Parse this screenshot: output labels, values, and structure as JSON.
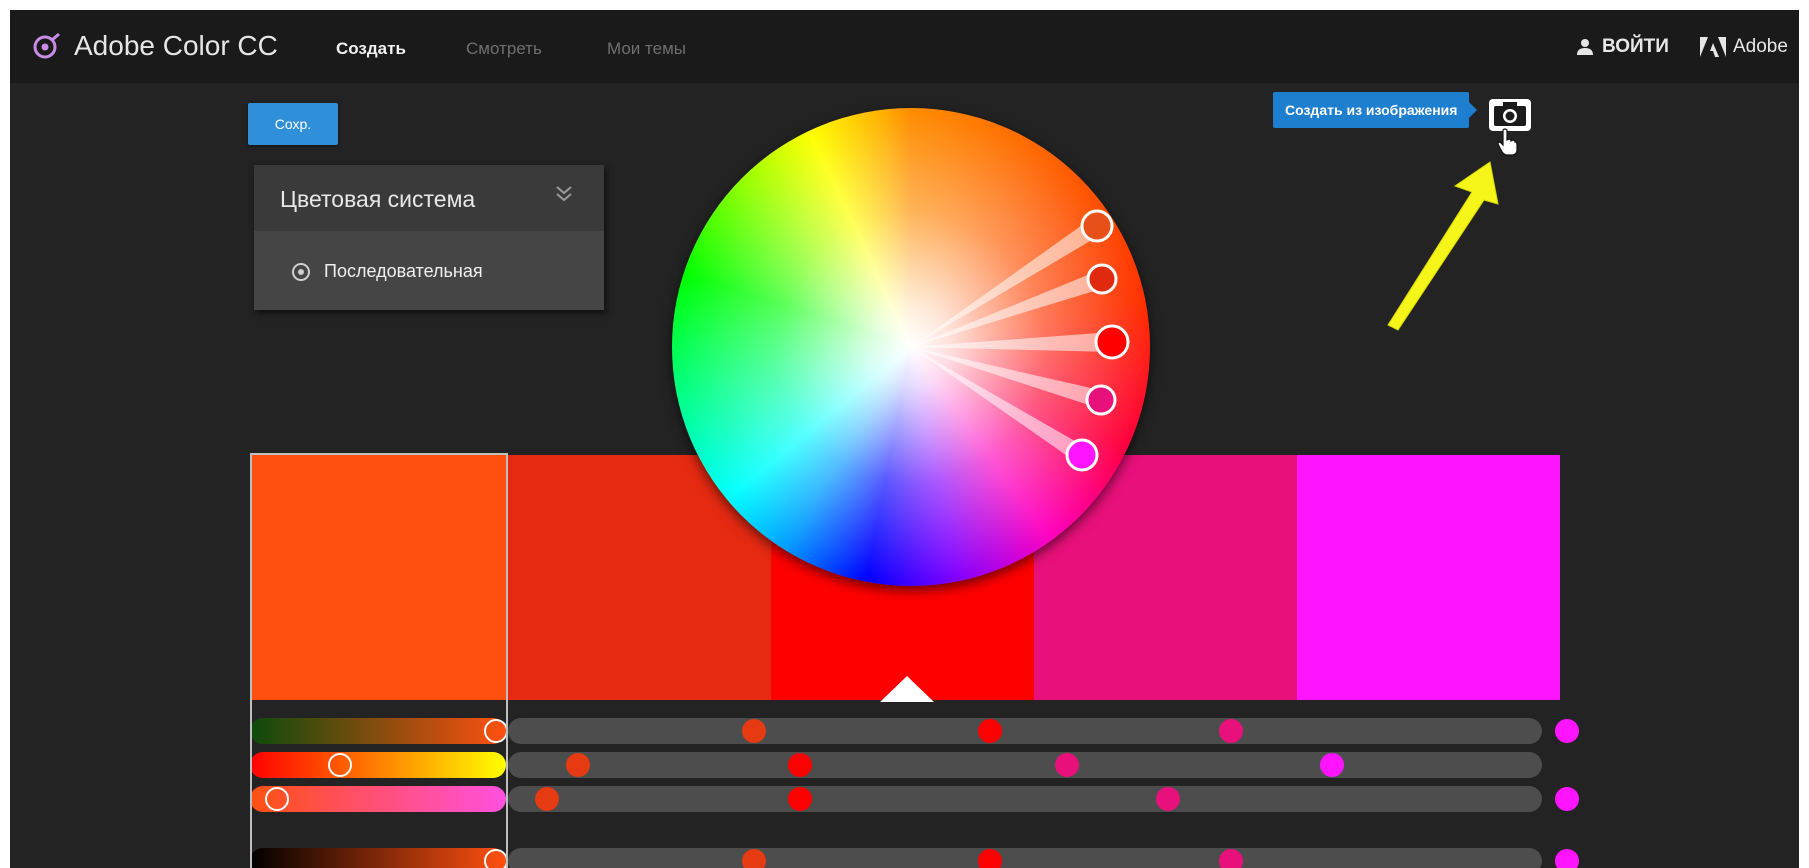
{
  "header": {
    "app_title": "Adobe Color CC",
    "nav": [
      {
        "label": "Создать",
        "active": true
      },
      {
        "label": "Смотреть",
        "active": false
      },
      {
        "label": "Мои темы",
        "active": false
      }
    ],
    "login_label": "ВОЙТИ",
    "adobe_label": "Adobe"
  },
  "toolbar": {
    "save_label": "Сохр."
  },
  "color_rule_panel": {
    "title": "Цветовая система",
    "selected_rule": "Последовательная"
  },
  "tooltip": {
    "label": "Создать из изображения"
  },
  "icons": [
    "adobe-color-logo-icon",
    "user-icon",
    "adobe-logo-icon",
    "camera-icon",
    "hand-cursor-icon",
    "chevron-double-down-icon",
    "radio-icon"
  ],
  "swatches": [
    {
      "color": "#ff5010",
      "selected": true
    },
    {
      "color": "#e62a12"
    },
    {
      "color": "#ff0000",
      "base": true
    },
    {
      "color": "#e8107a"
    },
    {
      "color": "#ff14ff"
    }
  ],
  "accent_color": "#2f8fd8",
  "annotation_arrow_color": "#f5f51a"
}
